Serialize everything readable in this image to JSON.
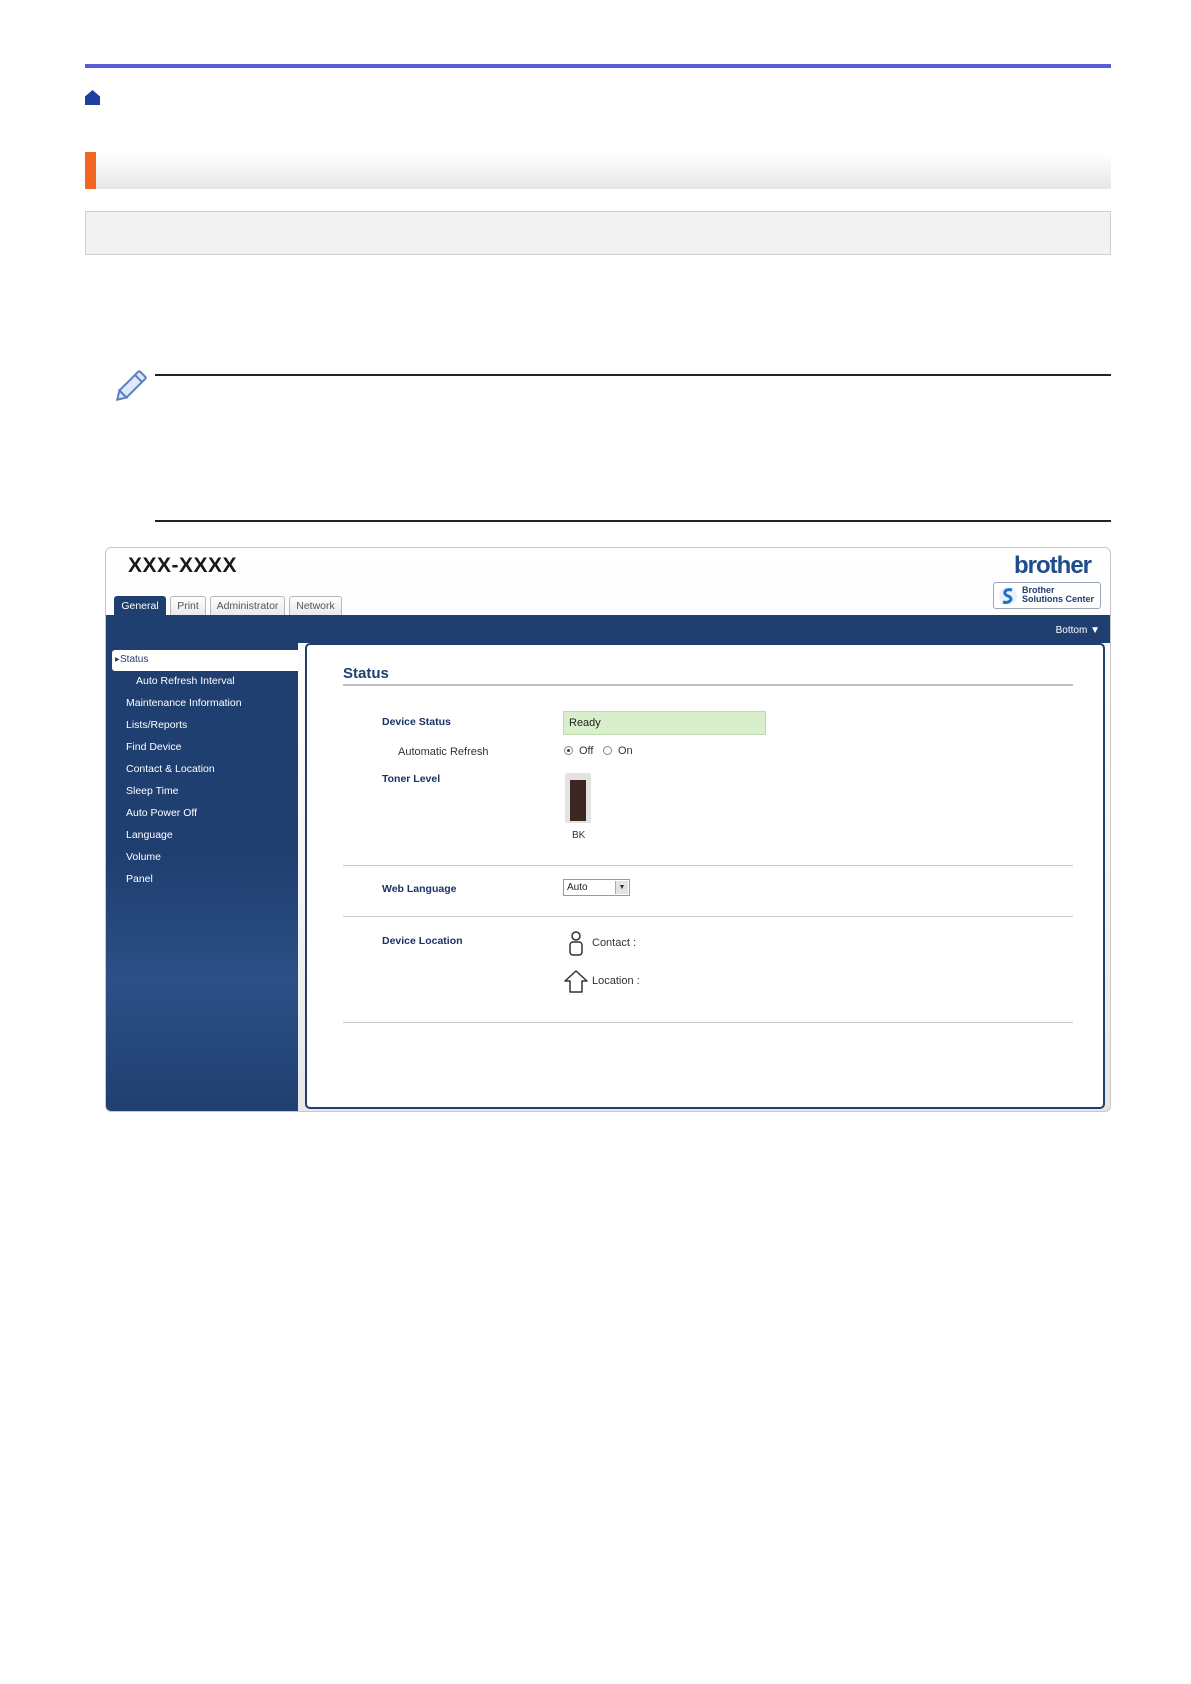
{
  "document": {
    "breadcrumb_icon": "home-icon",
    "note_icon": "pencil-icon",
    "colors": {
      "rule": "#5b5bd6",
      "accent": "#f26522",
      "ui_navy": "#1f3f70"
    }
  },
  "ui": {
    "model": "XXX-XXXX",
    "brand": "brother",
    "solutions_center": {
      "line1": "Brother",
      "line2": "Solutions Center"
    },
    "tabs": [
      {
        "label": "General",
        "active": true
      },
      {
        "label": "Print",
        "active": false
      },
      {
        "label": "Administrator",
        "active": false
      },
      {
        "label": "Network",
        "active": false
      }
    ],
    "bottom_link": "Bottom ▼",
    "sidebar": {
      "active": "Status",
      "items": [
        "Auto Refresh Interval",
        "Maintenance Information",
        "Lists/Reports",
        "Find Device",
        "Contact & Location",
        "Sleep Time",
        "Auto Power Off",
        "Language",
        "Volume",
        "Panel"
      ]
    },
    "panel": {
      "title": "Status",
      "device_status_label": "Device Status",
      "device_status_value": "Ready",
      "auto_refresh_label": "Automatic Refresh",
      "auto_refresh_off": "Off",
      "auto_refresh_on": "On",
      "auto_refresh_selected": "Off",
      "toner_label": "Toner Level",
      "toner_name": "BK",
      "toner_level": 0.9,
      "web_language_label": "Web Language",
      "web_language_value": "Auto",
      "device_location_label": "Device Location",
      "contact_label": "Contact :",
      "location_label": "Location :"
    }
  }
}
